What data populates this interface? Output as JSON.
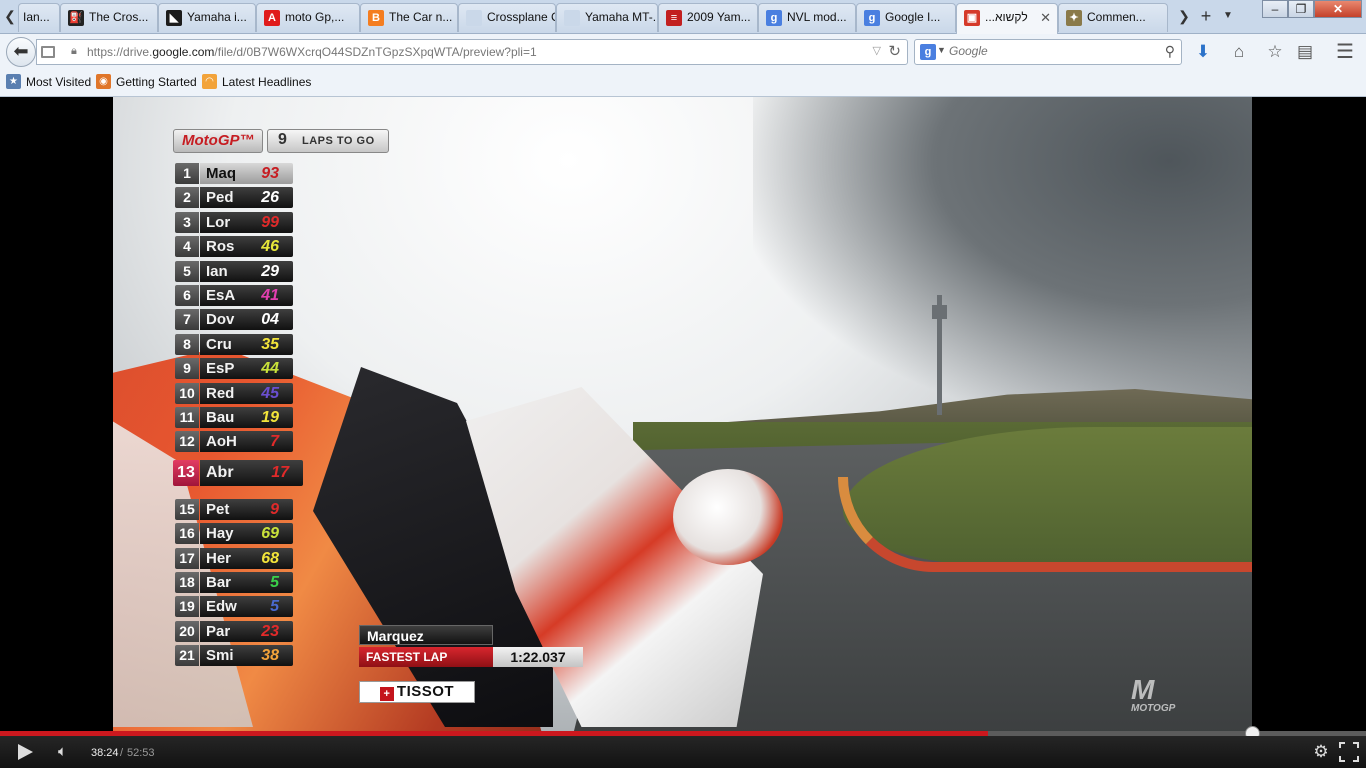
{
  "browser": {
    "tabs": [
      {
        "title": "Ian...",
        "icon": "page-icon",
        "color": "#7a7a7a"
      },
      {
        "title": "The Cros...",
        "icon": "motorbike-icon",
        "color": "#222222"
      },
      {
        "title": "Yamaha i...",
        "icon": "yamaha-icon",
        "color": "#1c1c1c"
      },
      {
        "title": "moto Gp,...",
        "icon": "letter-a-icon",
        "color": "#e01b1b"
      },
      {
        "title": "The Car n...",
        "icon": "blogger-icon",
        "color": "#f47d20"
      },
      {
        "title": "Crossplane Cr...",
        "icon": "blank-icon",
        "color": "#cad8e9"
      },
      {
        "title": "Yamaha MT-...",
        "icon": "blank-icon",
        "color": "#cad8e9"
      },
      {
        "title": "2009 Yam...",
        "icon": "stripe-icon",
        "color": "#c22020"
      },
      {
        "title": "NVL mod...",
        "icon": "google-icon",
        "color": "#4a7fe0"
      },
      {
        "title": "Google I...",
        "icon": "google-icon",
        "color": "#4a7fe0"
      },
      {
        "title": "...לקשוא",
        "icon": "clapperboard-icon",
        "color": "#d53a2a",
        "active": true
      },
      {
        "title": "Commen...",
        "icon": "monster-icon",
        "color": "#8a7a4a"
      }
    ],
    "url_prefix": "https://drive.",
    "url_domain": "google.com",
    "url_path": "/file/d/0B7W6WXcrqO44SDZnTGpzSXpqWTA/preview?pli=1",
    "search_placeholder": "Google",
    "search_engine_letter": "g",
    "bookmarks": [
      {
        "label": "Most Visited",
        "icon": "bookmark-star-icon",
        "color": "#5a7fb0"
      },
      {
        "label": "Getting Started",
        "icon": "firefox-icon",
        "color": "#e0762a"
      },
      {
        "label": "Latest Headlines",
        "icon": "rss-icon",
        "color": "#f2a33a"
      }
    ]
  },
  "video": {
    "badge": "MotoGP™",
    "laps_number": "9",
    "laps_text": "LAPS TO GO",
    "standings": [
      {
        "pos": "1",
        "name": "Maq",
        "num": "93",
        "color": "#c61d22"
      },
      {
        "pos": "2",
        "name": "Ped",
        "num": "26",
        "color": "#ffffff"
      },
      {
        "pos": "3",
        "name": "Lor",
        "num": "99",
        "color": "#e02a2a"
      },
      {
        "pos": "4",
        "name": "Ros",
        "num": "46",
        "color": "#e7e83a"
      },
      {
        "pos": "5",
        "name": "Ian",
        "num": "29",
        "color": "#ffffff"
      },
      {
        "pos": "6",
        "name": "EsA",
        "num": "41",
        "color": "#e23fb0"
      },
      {
        "pos": "7",
        "name": "Dov",
        "num": "04",
        "color": "#ffffff"
      },
      {
        "pos": "8",
        "name": "Cru",
        "num": "35",
        "color": "#f2e43a"
      },
      {
        "pos": "9",
        "name": "EsP",
        "num": "44",
        "color": "#c9e23a"
      },
      {
        "pos": "10",
        "name": "Red",
        "num": "45",
        "color": "#6a4fd0"
      },
      {
        "pos": "11",
        "name": "Bau",
        "num": "19",
        "color": "#f2e43a"
      },
      {
        "pos": "12",
        "name": "AoH",
        "num": "7",
        "color": "#e02a2a"
      },
      {
        "pos": "13",
        "name": "Abr",
        "num": "17",
        "color": "#e02a2a",
        "highlight": true
      },
      {
        "pos": "15",
        "name": "Pet",
        "num": "9",
        "color": "#e02a2a"
      },
      {
        "pos": "16",
        "name": "Hay",
        "num": "69",
        "color": "#c9e23a"
      },
      {
        "pos": "17",
        "name": "Her",
        "num": "68",
        "color": "#f2e43a"
      },
      {
        "pos": "18",
        "name": "Bar",
        "num": "5",
        "color": "#3ad04a"
      },
      {
        "pos": "19",
        "name": "Edw",
        "num": "5",
        "color": "#4a6ad0"
      },
      {
        "pos": "20",
        "name": "Par",
        "num": "23",
        "color": "#e02a2a"
      },
      {
        "pos": "21",
        "name": "Smi",
        "num": "38",
        "color": "#f2a33a"
      }
    ],
    "fastest_lap_rider": "Marquez",
    "fastest_lap_label": "FASTEST LAP",
    "fastest_lap_time": "1:22.037",
    "sponsor": "TISSOT",
    "watermark": "MOTOGP"
  },
  "player": {
    "current_time": "38:24",
    "separator": "/",
    "total_time": "52:53",
    "progress": 0.723
  }
}
